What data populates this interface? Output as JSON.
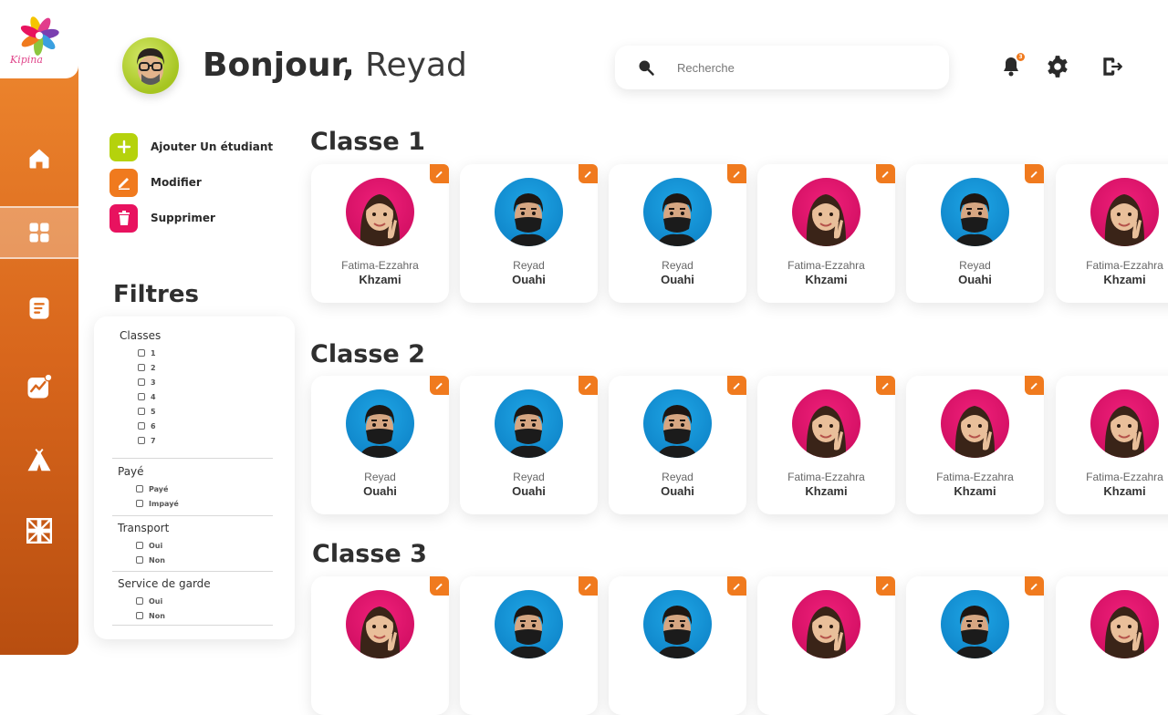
{
  "brand": {
    "name": "Kipina"
  },
  "header": {
    "greeting_hello": "Bonjour,",
    "greeting_name": "Reyad",
    "search_placeholder": "Recherche",
    "notification_count": "3"
  },
  "sidebar": {
    "items": [
      {
        "icon": "home-icon",
        "active": false
      },
      {
        "icon": "grid-icon",
        "active": true
      },
      {
        "icon": "notes-icon",
        "active": false
      },
      {
        "icon": "chart-icon",
        "active": false
      },
      {
        "icon": "tent-icon",
        "active": false
      },
      {
        "icon": "flag-icon",
        "active": false
      }
    ]
  },
  "actions": {
    "add": "Ajouter Un étudiant",
    "edit": "Modifier",
    "delete": "Supprimer"
  },
  "filters": {
    "title": "Filtres",
    "groups": [
      {
        "title": "Classes",
        "options": [
          "1",
          "2",
          "3",
          "4",
          "5",
          "6",
          "7"
        ]
      },
      {
        "title": "Payé",
        "options": [
          "Payé",
          "Impayé"
        ]
      },
      {
        "title": "Transport",
        "options": [
          "Oui",
          "Non"
        ]
      },
      {
        "title": "Service de garde",
        "options": [
          "Oui",
          "Non"
        ]
      }
    ]
  },
  "classes": [
    {
      "title": "Classe 1",
      "students": [
        {
          "first": "Fatima-Ezzahra",
          "last": "Khzami",
          "avatar": "girl"
        },
        {
          "first": "Reyad",
          "last": "Ouahi",
          "avatar": "boy"
        },
        {
          "first": "Reyad",
          "last": "Ouahi",
          "avatar": "boy"
        },
        {
          "first": "Fatima-Ezzahra",
          "last": "Khzami",
          "avatar": "girl"
        },
        {
          "first": "Reyad",
          "last": "Ouahi",
          "avatar": "boy"
        },
        {
          "first": "Fatima-Ezzahra",
          "last": "Khzami",
          "avatar": "girl"
        }
      ]
    },
    {
      "title": "Classe 2",
      "students": [
        {
          "first": "Reyad",
          "last": "Ouahi",
          "avatar": "boy"
        },
        {
          "first": "Reyad",
          "last": "Ouahi",
          "avatar": "boy"
        },
        {
          "first": "Reyad",
          "last": "Ouahi",
          "avatar": "boy"
        },
        {
          "first": "Fatima-Ezzahra",
          "last": "Khzami",
          "avatar": "girl"
        },
        {
          "first": "Fatima-Ezzahra",
          "last": "Khzami",
          "avatar": "girl"
        },
        {
          "first": "Fatima-Ezzahra",
          "last": "Khzami",
          "avatar": "girl"
        }
      ]
    },
    {
      "title": "Classe 3",
      "students": [
        {
          "avatar": "girl"
        },
        {
          "avatar": "boy"
        },
        {
          "avatar": "boy"
        },
        {
          "avatar": "girl"
        },
        {
          "avatar": "boy"
        },
        {
          "avatar": "girl"
        }
      ]
    }
  ],
  "colors": {
    "accent": "#f07a1e",
    "add": "#b5d20c",
    "delete": "#e8125f",
    "girl_avatar": "#e8146c",
    "boy_avatar": "#1496d8"
  }
}
